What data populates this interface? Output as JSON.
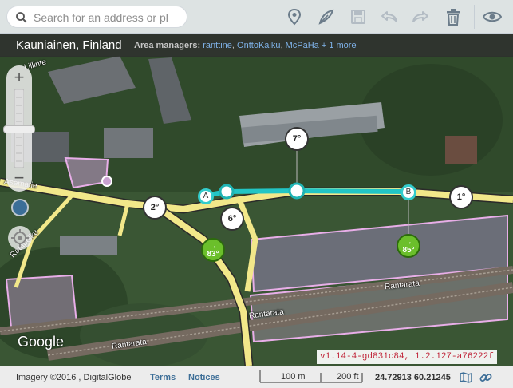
{
  "search": {
    "placeholder": "Search for an address or pl"
  },
  "toolbar": {
    "icons": [
      "map-pin-icon",
      "draw-line-icon",
      "save-icon",
      "undo-icon",
      "redo-icon",
      "trash-icon",
      "eye-icon"
    ]
  },
  "info": {
    "location": "Kauniainen, Finland",
    "managers_label": "Area managers:",
    "managers": [
      "ranttine",
      "OnttoKaiku",
      "McPaHa"
    ],
    "more": "+ 1 more"
  },
  "zoom": {
    "in": "+",
    "out": "−"
  },
  "map": {
    "angles": [
      "7°",
      "2°",
      "6°",
      "1°"
    ],
    "endpoints": [
      "A",
      "B"
    ],
    "turns": [
      {
        "arrow": "→",
        "deg": "83°"
      },
      {
        "arrow": "→",
        "deg": "85°"
      }
    ],
    "streets": [
      "Rantarata",
      "Rantarata",
      "Rantarata",
      "Ratapolku",
      "Asematie",
      "Lillinte"
    ]
  },
  "google_logo": "Google",
  "version": "v1.14-4-gd831c84, 1.2.127-a76222f",
  "footer": {
    "imagery": "Imagery ©2016 , DigitalGlobe",
    "terms": "Terms",
    "notices": "Notices",
    "scale_metric": "100 m",
    "scale_imperial": "200 ft",
    "coords": "24.72913 60.21245"
  }
}
